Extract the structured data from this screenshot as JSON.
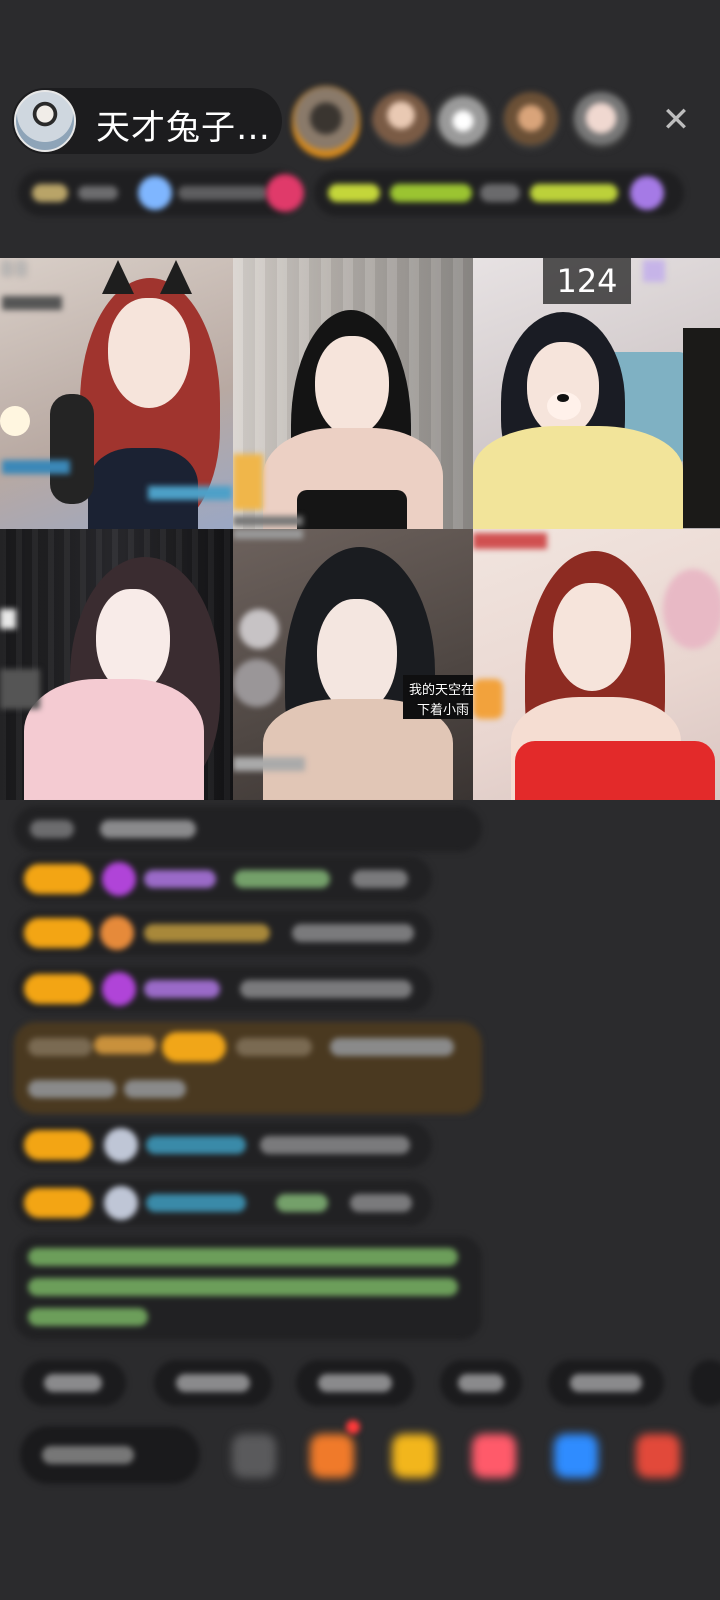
{
  "header": {
    "host_name": "天才兔子…",
    "close_icon": "close-icon"
  },
  "video_grid": {
    "counter": "124"
  }
}
